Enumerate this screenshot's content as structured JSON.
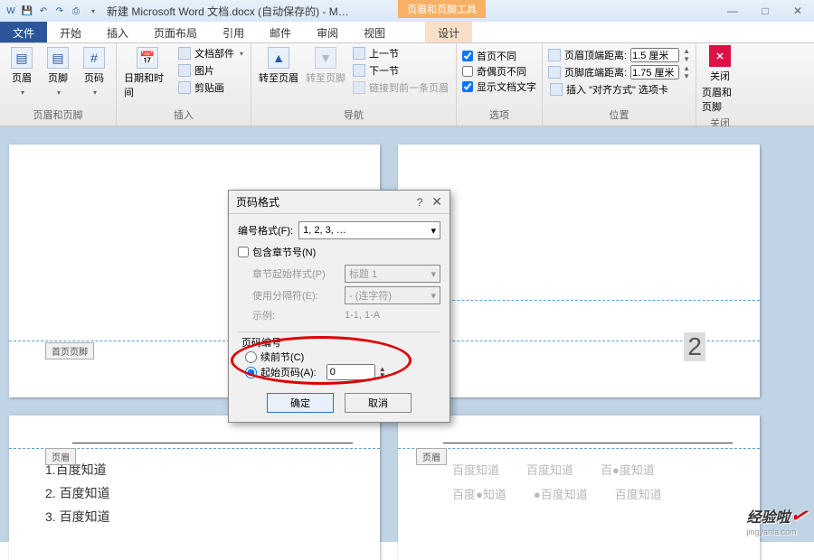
{
  "titlebar": {
    "title": "新建 Microsoft Word 文档.docx (自动保存的) - M…",
    "tool_tab": "页眉和页脚工具",
    "win": {
      "min": "—",
      "max": "□",
      "close": "✕"
    }
  },
  "tabs": {
    "file": "文件",
    "items": [
      "开始",
      "插入",
      "页面布局",
      "引用",
      "邮件",
      "审阅",
      "视图"
    ],
    "design": "设计"
  },
  "ribbon": {
    "g1": {
      "header": "页眉",
      "footer": "页脚",
      "pagenum": "页码",
      "label": "页眉和页脚"
    },
    "g2": {
      "datetime": "日期和时间",
      "parts": "文档部件",
      "picture": "图片",
      "clipart": "剪贴画",
      "label": "插入"
    },
    "g3": {
      "gotoheader": "转至页眉",
      "gotofooter": "转至页脚",
      "prev": "上一节",
      "next": "下一节",
      "link": "链接到前一条页眉",
      "label": "导航"
    },
    "g4": {
      "firstdiff": "首页不同",
      "oddeven": "奇偶页不同",
      "showtext": "显示文档文字",
      "label": "选项"
    },
    "g5": {
      "topdist": "页眉顶端距离:",
      "topval": "1.5 厘米",
      "botdist": "页脚底端距离:",
      "botval": "1.75 厘米",
      "align": "插入 \"对齐方式\" 选项卡",
      "label": "位置"
    },
    "g6": {
      "close": "关闭",
      "sub": "页眉和页脚",
      "label": "关闭"
    }
  },
  "pages": {
    "p1_tag": "首页页脚",
    "p2_pagenum": "2",
    "p3_tag": "页眉",
    "p3_lines": [
      "1.百度知道",
      "2.   百度知道",
      "3.   百度知道"
    ],
    "p4_tag": "页眉",
    "p4_row1": [
      "百度知道",
      "百度知道",
      "百●度知道"
    ],
    "p4_row2": [
      "百度●知道",
      "●百度知道",
      "百度知道"
    ]
  },
  "dialog": {
    "title": "页码格式",
    "numfmt_label": "编号格式(F):",
    "numfmt_val": "1, 2, 3, …",
    "include_chapter": "包含章节号(N)",
    "chapter_style_label": "章节起始样式(P)",
    "chapter_style_val": "标题 1",
    "separator_label": "使用分隔符(E):",
    "separator_val": "-   (连字符)",
    "example_label": "示例:",
    "example_val": "1-1, 1-A",
    "numbering_legend": "页码编号",
    "cont_label": "续前节(C)",
    "start_label": "起始页码(A):",
    "start_val": "0",
    "ok": "确定",
    "cancel": "取消"
  },
  "watermark": {
    "text": "经验啦",
    "sub": "jingyanla.com"
  }
}
